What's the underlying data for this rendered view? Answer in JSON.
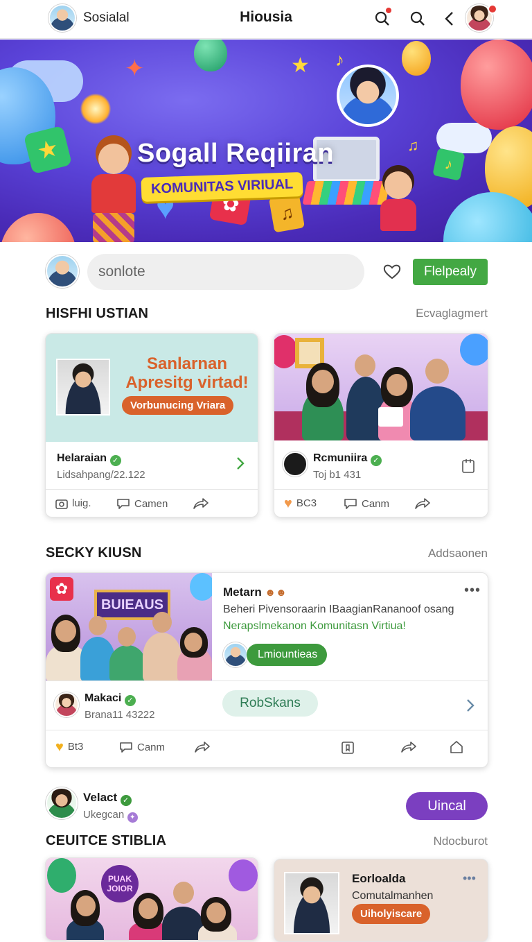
{
  "topbar": {
    "brand": "Sosialal",
    "title": "Hiousia",
    "icons": [
      "search-notification-icon",
      "search-icon",
      "back-chevron-icon"
    ]
  },
  "hero": {
    "title": "Sogall Reqiiran",
    "subtitle": "KOMUNITAS VIRIUAL"
  },
  "composer": {
    "placeholder": "sonlote",
    "button": "Flelpealy"
  },
  "section1": {
    "title": "HISFHI USTIAN",
    "link": "Ecvaglagmert",
    "card1": {
      "headline": "Sanlarnan Apresitg virtad!",
      "tag": "Vorbunucing Vriara",
      "name": "Helaraian",
      "sub": "Lidsahpang/22.122",
      "actions": [
        "luig.",
        "Camen"
      ]
    },
    "card2": {
      "name": "Rcmuniira",
      "sub": "Toj b1 431",
      "actions": [
        "BC3",
        "Canm"
      ]
    }
  },
  "section2": {
    "title": "SECKY KIUSN",
    "link": "Addsaonen",
    "card": {
      "banner_text": "BUIEAUS",
      "author": "Metarn",
      "line1": "Beheri Pivensoraarin IBaagianRananoof osang",
      "line2": "Nerapslmekanon Komunitasn Virtiua!",
      "chip": "Lmiountieas",
      "name": "Makaci",
      "sub": "Brana11 43222",
      "pill": "RobSkans",
      "actions": [
        "Bt3",
        "Canm"
      ]
    }
  },
  "suggested": {
    "name": "Velact",
    "sub": "Ukegcan",
    "button": "Uincal"
  },
  "section3": {
    "title": "CEUITCE STIBLIA",
    "link": "Ndocburot",
    "card2": {
      "name": "Eorloalda",
      "sub": "Comutalmanhen",
      "tag": "Uiholyiscare"
    },
    "card1_badge": "PUAK JOIOR"
  },
  "colors": {
    "accent_green": "#43a843",
    "accent_purple": "#7b3fc0",
    "hero_yellow": "#ffdd33",
    "tag_orange": "#d9622b"
  }
}
